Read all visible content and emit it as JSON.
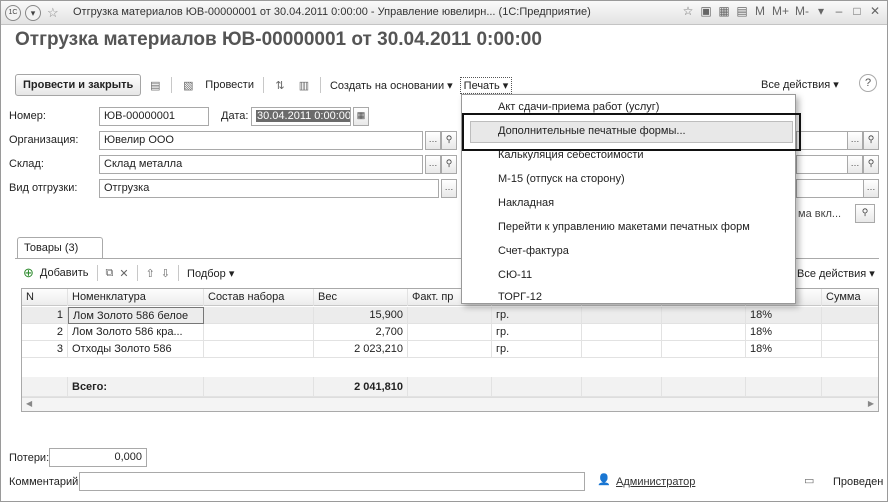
{
  "window": {
    "title": "Отгрузка материалов ЮВ-00000001 от 30.04.2011 0:00:00 - Управление ювелирн... (1С:Предприятие)",
    "logo_text": "1С",
    "controls": [
      "M",
      "M+",
      "M-"
    ]
  },
  "doc_title": "Отгрузка материалов ЮВ-00000001 от 30.04.2011 0:00:00",
  "toolbar": {
    "post_close_label": "Провести и закрыть",
    "post_label": "Провести",
    "create_based_label": "Создать на основании",
    "print_label": "Печать",
    "all_actions_label": "Все действия",
    "help_label": "?"
  },
  "form": {
    "number_label": "Номер:",
    "number_value": "ЮВ-00000001",
    "date_label": "Дата:",
    "date_value": "30.04.2011  0:00:00",
    "org_label": "Организация:",
    "org_value": "Ювелир ООО",
    "warehouse_label": "Склад:",
    "warehouse_value": "Склад металла",
    "shipment_type_label": "Вид отгрузки:",
    "shipment_type_value": "Отгрузка",
    "partial_text": "ма вкл..."
  },
  "tab": {
    "label": "Товары (3)"
  },
  "subtoolbar": {
    "add_label": "Добавить",
    "select_label": "Подбор",
    "all_actions_label": "Все действия"
  },
  "table": {
    "columns": [
      "N",
      "Номенклатура",
      "Состав набора",
      "Вес",
      "Факт. пр",
      "",
      "",
      "",
      "",
      "Сумма"
    ],
    "rows": [
      {
        "n": "1",
        "name": "Лом Золото 586 белое",
        "set": "",
        "weight": "15,900",
        "unit": "гр.",
        "vat": "18%"
      },
      {
        "n": "2",
        "name": "Лом Золото 586 кра...",
        "set": "",
        "weight": "2,700",
        "unit": "гр.",
        "vat": "18%"
      },
      {
        "n": "3",
        "name": "Отходы Золото 586",
        "set": "",
        "weight": "2 023,210",
        "unit": "гр.",
        "vat": "18%"
      }
    ],
    "total_label": "Всего:",
    "total_weight": "2 041,810"
  },
  "footer": {
    "losses_label": "Потери:",
    "losses_value": "0,000",
    "comment_label": "Комментарий:",
    "author_label": "Администратор",
    "status_label": "Проведен"
  },
  "print_menu": {
    "items": [
      "Акт сдачи-приема работ (услуг)",
      "Дополнительные печатные формы...",
      "Калькуляция себестоимости",
      "М-15 (отпуск на сторону)",
      "Накладная",
      "Перейти к управлению макетами печатных форм",
      "Счет-фактура",
      "СЮ-11",
      "ТОРГ-12"
    ],
    "highlighted_index": 1
  }
}
